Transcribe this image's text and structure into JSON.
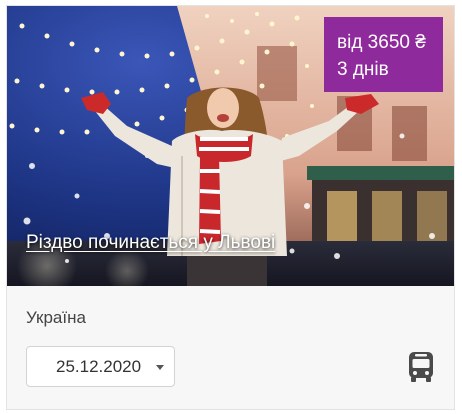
{
  "tour": {
    "title": "Різдво починається у Львові",
    "price": "від 3650 ₴",
    "duration": "3 днів",
    "country": "Україна",
    "date": "25.12.2020",
    "transport_icon": "bus-icon"
  },
  "colors": {
    "badge": "#8e2a9b",
    "night_sky": "#1f3a8a",
    "building": "#e0b8a4",
    "lights": "#fff6d0",
    "scarf_red": "#c8282c",
    "coat": "#ece6dc",
    "gloves": "#cc2a2a",
    "icon": "#4a4a4a"
  }
}
